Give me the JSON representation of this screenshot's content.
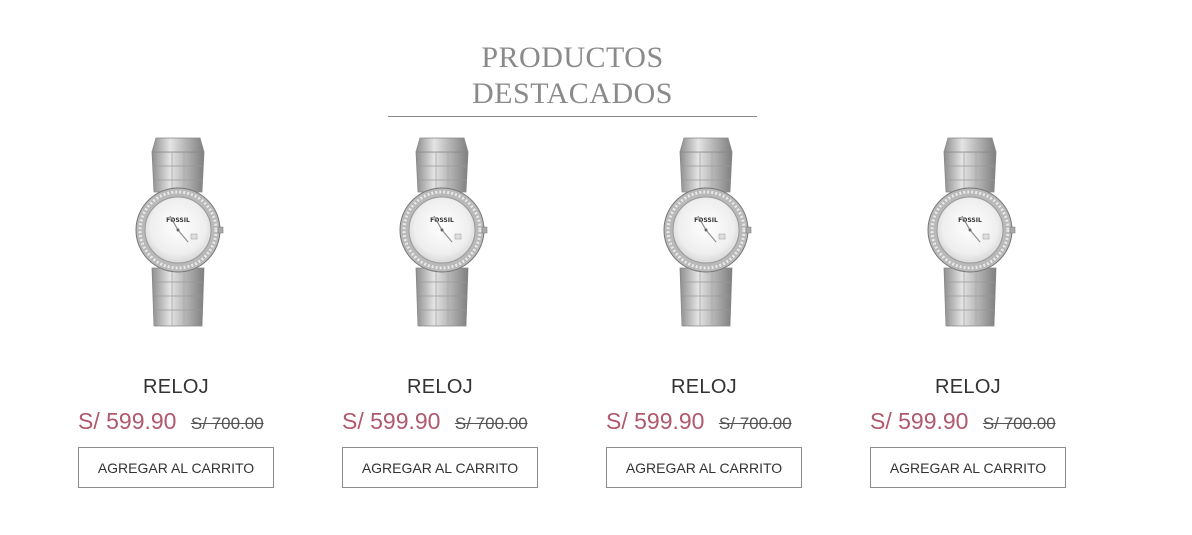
{
  "section": {
    "title": "PRODUCTOS DESTACADOS"
  },
  "products": [
    {
      "name": "RELOJ",
      "price": "S/ 599.90",
      "old_price": "S/ 700.00",
      "button_label": "AGREGAR AL CARRITO",
      "image_icon": "silver-watch-icon",
      "brand_on_dial": "FOSSIL"
    },
    {
      "name": "RELOJ",
      "price": "S/ 599.90",
      "old_price": "S/ 700.00",
      "button_label": "AGREGAR AL CARRITO",
      "image_icon": "silver-watch-icon",
      "brand_on_dial": "FOSSIL"
    },
    {
      "name": "RELOJ",
      "price": "S/ 599.90",
      "old_price": "S/ 700.00",
      "button_label": "AGREGAR AL CARRITO",
      "image_icon": "silver-watch-icon",
      "brand_on_dial": "FOSSIL"
    },
    {
      "name": "RELOJ",
      "price": "S/ 599.90",
      "old_price": "S/ 700.00",
      "button_label": "AGREGAR AL CARRITO",
      "image_icon": "silver-watch-icon",
      "brand_on_dial": "FOSSIL"
    }
  ],
  "colors": {
    "title": "#8a8a8a",
    "price_accent": "#b0596d",
    "text": "#333333"
  }
}
